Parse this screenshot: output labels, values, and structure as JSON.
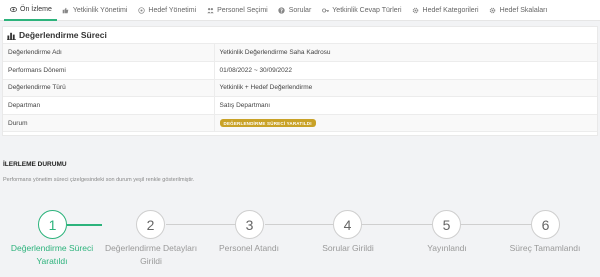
{
  "tabs": [
    {
      "label": "Ön İzleme",
      "icon": "eye-icon",
      "active": true
    },
    {
      "label": "Yetkinlik Yönetimi",
      "icon": "thumbs-up-icon",
      "active": false
    },
    {
      "label": "Hedef Yönetimi",
      "icon": "target-icon",
      "active": false
    },
    {
      "label": "Personel Seçimi",
      "icon": "users-icon",
      "active": false
    },
    {
      "label": "Sorular",
      "icon": "question-icon",
      "active": false
    },
    {
      "label": "Yetkinlik Cevap Türleri",
      "icon": "key-icon",
      "active": false
    },
    {
      "label": "Hedef Kategorileri",
      "icon": "gear-icon",
      "active": false
    },
    {
      "label": "Hedef Skalaları",
      "icon": "gear-icon",
      "active": false
    }
  ],
  "process": {
    "title": "Değerlendirme Süreci",
    "rows": [
      {
        "key": "Değerlendirme Adı",
        "value": "Yetkinlik Değerlendirme Saha Kadrosu"
      },
      {
        "key": "Performans Dönemi",
        "value": "01/08/2022 ~ 30/09/2022"
      },
      {
        "key": "Değerlendirme Türü",
        "value": "Yetkinlik + Hedef Değerlendirme"
      },
      {
        "key": "Departman",
        "value": "Satış Departmanı"
      }
    ],
    "status_key": "Durum",
    "status_value": "DEĞERLENDİRME SÜRECİ YARATILDI",
    "status_color": "#c9a227"
  },
  "progress": {
    "title": "İLERLEME DURUMU",
    "description": "Performans yönetim süreci çizelgesindeki son durum yeşil renkle gösterilmiştir.",
    "accent": "#2db37c",
    "steps": [
      {
        "number": "1",
        "label": "Değerlendirme Süreci Yaratıldı",
        "done": true
      },
      {
        "number": "2",
        "label": "Değerlendirme Detayları Girildi",
        "done": false
      },
      {
        "number": "3",
        "label": "Personel Atandı",
        "done": false
      },
      {
        "number": "4",
        "label": "Sorular Girildi",
        "done": false
      },
      {
        "number": "5",
        "label": "Yayınlandı",
        "done": false
      },
      {
        "number": "6",
        "label": "Süreç Tamamlandı",
        "done": false
      }
    ]
  }
}
